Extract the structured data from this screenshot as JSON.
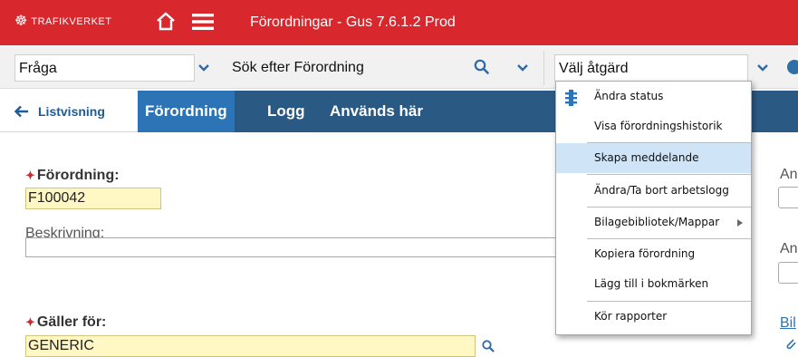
{
  "header": {
    "brand": "TRAFIKVERKET",
    "title": "Förordningar - Gus 7.6.1.2 Prod"
  },
  "toolbar": {
    "query_select": "Fråga",
    "search_placeholder": "Sök efter Förordning",
    "action_select": "Välj åtgärd"
  },
  "tabs": {
    "back": "Listvisning",
    "items": [
      "Förordning",
      "Logg",
      "Används här"
    ]
  },
  "form": {
    "forordning_label": "Förordning:",
    "forordning_value": "F100042",
    "beskrivning_label": "Beskrivning:",
    "beskrivning_value": "",
    "galler_label": "Gäller för:",
    "galler_value": "GENERIC",
    "right_label_1": "An",
    "right_label_2": "An",
    "right_link": "Bil"
  },
  "menu": {
    "items": [
      "Ändra status",
      "Visa förordningshistorik",
      "Skapa meddelande",
      "Ändra/Ta bort arbetslogg",
      "Bilagebibliotek/Mappar",
      "Kopiera förordning",
      "Lägg till i bokmärken",
      "Kör rapporter"
    ],
    "highlighted_index": 2
  },
  "colors": {
    "header_red": "#d8282e",
    "tab_dark": "#2a5a84",
    "tab_active": "#2d74b6",
    "required_yellow": "#fff7c4",
    "menu_highlight": "#cfe4f7"
  }
}
